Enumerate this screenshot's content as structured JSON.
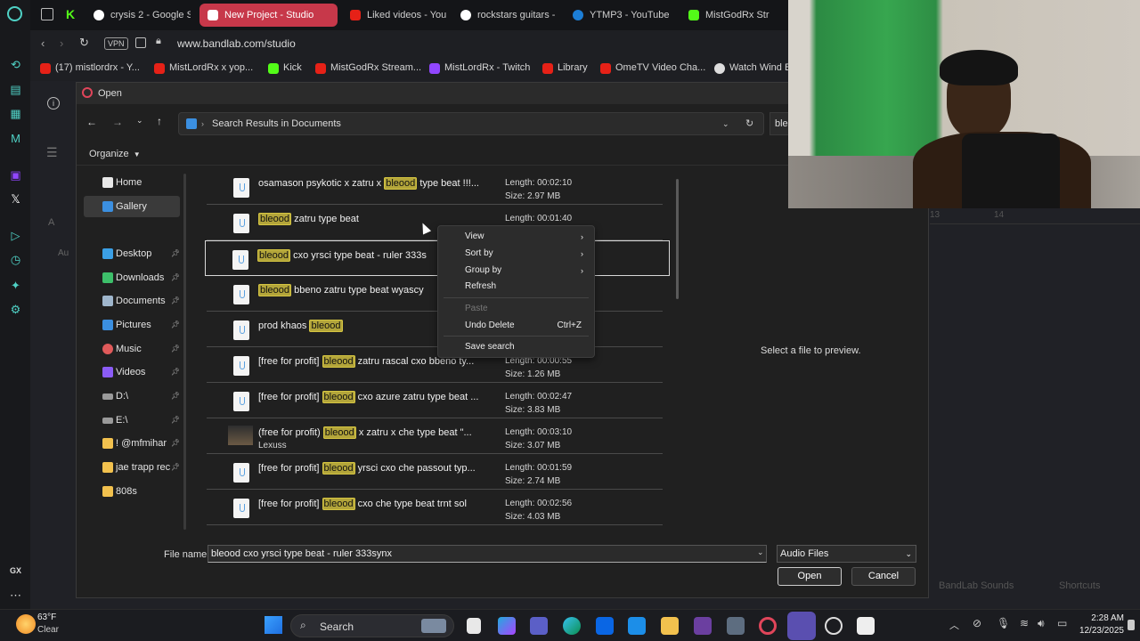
{
  "browser": {
    "tabs": [
      {
        "label": "crysis 2 - Google S",
        "active": false,
        "color": "#ffffff"
      },
      {
        "label": "New Project - Studio",
        "active": true,
        "color": "#e0455a"
      },
      {
        "label": "Liked videos - You",
        "active": false,
        "color": "#e62117"
      },
      {
        "label": "rockstars guitars -",
        "active": false,
        "color": "#ffffff"
      },
      {
        "label": "YTMP3 - YouTube",
        "active": false,
        "color": "#1c7ed6"
      },
      {
        "label": "MistGodRx Str",
        "active": false,
        "color": "#53fc18"
      }
    ],
    "vpn_label": "VPN",
    "url": "www.bandlab.com/studio",
    "bookmarks": [
      {
        "label": "(17) mistlordrx - Y...",
        "color": "#e62117"
      },
      {
        "label": "MistLordRx x yop...",
        "color": "#e62117"
      },
      {
        "label": "Kick",
        "color": "#53fc18"
      },
      {
        "label": "MistGodRx Stream...",
        "color": "#e62117"
      },
      {
        "label": "MistLordRx - Twitch",
        "color": "#9146ff"
      },
      {
        "label": "Library",
        "color": "#e62117"
      },
      {
        "label": "OmeTV Video Cha...",
        "color": "#e62117"
      },
      {
        "label": "Watch Wind B",
        "color": "#dddddd"
      }
    ]
  },
  "dialog": {
    "title": "Open",
    "path_label": "Search Results in Documents",
    "search_value": "ble",
    "organize_label": "Organize",
    "nav_items": [
      {
        "label": "Home",
        "icon": "home-icon",
        "color": "#e8e8e8",
        "pinned": false
      },
      {
        "label": "Gallery",
        "icon": "gallery-icon",
        "color": "#3b8fe0",
        "pinned": false,
        "selected": true
      },
      {
        "label": "Desktop",
        "icon": "desktop-icon",
        "color": "#3ba0e6",
        "pinned": true
      },
      {
        "label": "Downloads",
        "icon": "download-icon",
        "color": "#3dbf6a",
        "pinned": true
      },
      {
        "label": "Documents",
        "icon": "document-icon",
        "color": "#9fb6cc",
        "pinned": true
      },
      {
        "label": "Pictures",
        "icon": "pictures-icon",
        "color": "#3b8fe0",
        "pinned": true
      },
      {
        "label": "Music",
        "icon": "music-icon",
        "color": "#e05a5a",
        "pinned": true
      },
      {
        "label": "Videos",
        "icon": "videos-icon",
        "color": "#8b5cf6",
        "pinned": true
      },
      {
        "label": "D:\\",
        "icon": "drive-icon",
        "color": "#9a9a9a",
        "pinned": true
      },
      {
        "label": "E:\\",
        "icon": "drive-icon",
        "color": "#9a9a9a",
        "pinned": true
      },
      {
        "label": "! @mfmihar",
        "icon": "folder-icon",
        "color": "#f2c14e",
        "pinned": true
      },
      {
        "label": "jae trapp rec",
        "icon": "folder-icon",
        "color": "#f2c14e",
        "pinned": true
      },
      {
        "label": "808s",
        "icon": "folder-icon",
        "color": "#f2c14e",
        "pinned": false
      }
    ],
    "files": [
      {
        "pre": "osamason psykotic x zatru x ",
        "hl": "bleood",
        "post": " type beat !!!...",
        "length": "Length: 00:02:10",
        "size": "Size: 2.97 MB",
        "thumb": false,
        "sub": ""
      },
      {
        "pre": "",
        "hl": "bleood",
        "post": " zatru type beat",
        "length": "Length: 00:01:40",
        "size": "",
        "thumb": false,
        "sub": ""
      },
      {
        "pre": "",
        "hl": "bleood",
        "post": " cxo yrsci type beat - ruler 333s",
        "length": "",
        "size": "",
        "thumb": false,
        "sub": "",
        "selected": true
      },
      {
        "pre": "",
        "hl": "bleood",
        "post": " bbeno zatru type beat wyascy",
        "length": "",
        "size": "",
        "thumb": false,
        "sub": ""
      },
      {
        "pre": "prod khaos ",
        "hl": "bleood",
        "post": "",
        "length": "",
        "size": "",
        "thumb": false,
        "sub": ""
      },
      {
        "pre": "[free for profit] ",
        "hl": "bleood",
        "post": " zatru rascal cxo bbeno ty...",
        "length": "Length: 00:00:55",
        "size": "Size: 1.26 MB",
        "thumb": false,
        "sub": ""
      },
      {
        "pre": "[free for profit] ",
        "hl": "bleood",
        "post": " cxo azure zatru type beat ...",
        "length": "Length: 00:02:47",
        "size": "Size: 3.83 MB",
        "thumb": false,
        "sub": ""
      },
      {
        "pre": "(free for profit) ",
        "hl": "bleood",
        "post": " x zatru x che type beat \"...",
        "length": "Length: 00:03:10",
        "size": "Size: 3.07 MB",
        "thumb": true,
        "sub": "Lexuss"
      },
      {
        "pre": "[free for profit] ",
        "hl": "bleood",
        "post": " yrsci cxo che passout typ...",
        "length": "Length: 00:01:59",
        "size": "Size: 2.74 MB",
        "thumb": false,
        "sub": ""
      },
      {
        "pre": "[free for profit] ",
        "hl": "bleood",
        "post": " cxo che type beat trnt sol",
        "length": "Length: 00:02:56",
        "size": "Size: 4.03 MB",
        "thumb": false,
        "sub": ""
      }
    ],
    "context_menu": [
      {
        "label": "View",
        "submenu": true,
        "disabled": false,
        "shortcut": ""
      },
      {
        "label": "Sort by",
        "submenu": true,
        "disabled": false,
        "shortcut": ""
      },
      {
        "label": "Group by",
        "submenu": true,
        "disabled": false,
        "shortcut": ""
      },
      {
        "label": "Refresh",
        "submenu": false,
        "disabled": false,
        "shortcut": ""
      },
      {
        "label": "Paste",
        "submenu": false,
        "disabled": true,
        "shortcut": ""
      },
      {
        "label": "Undo Delete",
        "submenu": false,
        "disabled": false,
        "shortcut": "Ctrl+Z"
      },
      {
        "label": "Save search",
        "submenu": false,
        "disabled": false,
        "shortcut": ""
      }
    ],
    "preview_text": "Select a file to preview.",
    "filename_label": "File name:",
    "filename_value": "bleood cxo yrsci type beat - ruler 333synx",
    "filetype_value": "Audio Files",
    "open_label": "Open",
    "cancel_label": "Cancel"
  },
  "background_page": {
    "timeline_13": "13",
    "timeline_14": "14",
    "bandlab_sounds": "BandLab Sounds",
    "shortcuts": "Shortcuts",
    "au_label": "Au",
    "a_label": "A"
  },
  "taskbar": {
    "temperature": "63°F",
    "weather": "Clear",
    "search_label": "Search",
    "time": "2:28 AM",
    "date": "12/23/2025"
  }
}
